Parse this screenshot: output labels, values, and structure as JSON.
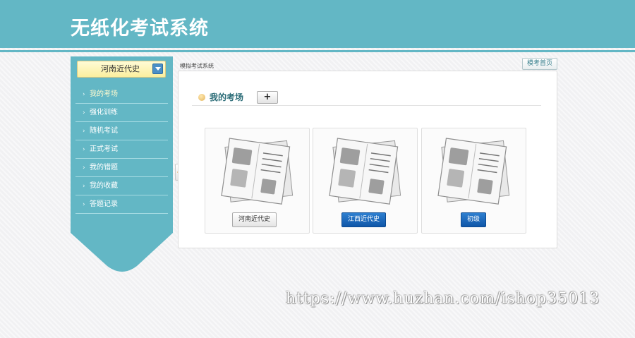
{
  "header": {
    "title": "无纸化考试系统"
  },
  "sidebar": {
    "subject_select": {
      "selected": "河南近代史"
    },
    "items": [
      {
        "label": "我的考场"
      },
      {
        "label": "强化训练"
      },
      {
        "label": "随机考试"
      },
      {
        "label": "正式考试"
      },
      {
        "label": "我的错题"
      },
      {
        "label": "我的收藏"
      },
      {
        "label": "答题记录"
      }
    ],
    "item_arrow": "›"
  },
  "main": {
    "breadcrumb": "模拟考试系统",
    "home_link": "模考首页",
    "section_title": "我的考场",
    "add_button": "+",
    "cards": [
      {
        "label": "河南近代史",
        "style": "light"
      },
      {
        "label": "江西近代史",
        "style": "dark"
      },
      {
        "label": "初级",
        "style": "dark"
      }
    ]
  },
  "watermark": "https://www.huzhan.com/ishop35013",
  "colors": {
    "header": "#63b7c5",
    "sidebar": "#63b7c5",
    "primary_button": "#1465b8"
  }
}
